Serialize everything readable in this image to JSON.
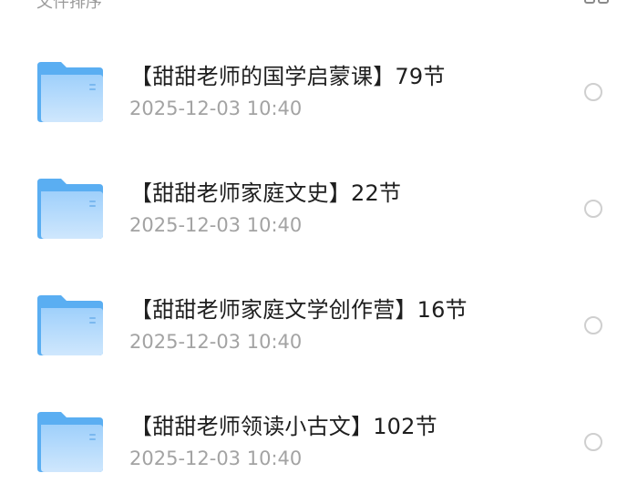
{
  "header": {
    "partial_text": "文件排序",
    "view_toggle_icon": "grid-icon"
  },
  "files": [
    {
      "name": "【甜甜老师的国学启蒙课】79节",
      "date": "2025-12-03 10:40",
      "icon": "folder-icon"
    },
    {
      "name": "【甜甜老师家庭文史】22节",
      "date": "2025-12-03 10:40",
      "icon": "folder-icon"
    },
    {
      "name": "【甜甜老师家庭文学创作营】16节",
      "date": "2025-12-03 10:40",
      "icon": "folder-icon"
    },
    {
      "name": "【甜甜老师领读小古文】102节",
      "date": "2025-12-03 10:40",
      "icon": "folder-icon"
    }
  ],
  "colors": {
    "folder_back": "#5aaef2",
    "folder_front_top": "#9fd0fb",
    "folder_front_bottom": "#cfe7fd",
    "title_text": "#1e1e1e",
    "date_text": "#a3a3a3",
    "radio_border": "#cfcfcf"
  }
}
